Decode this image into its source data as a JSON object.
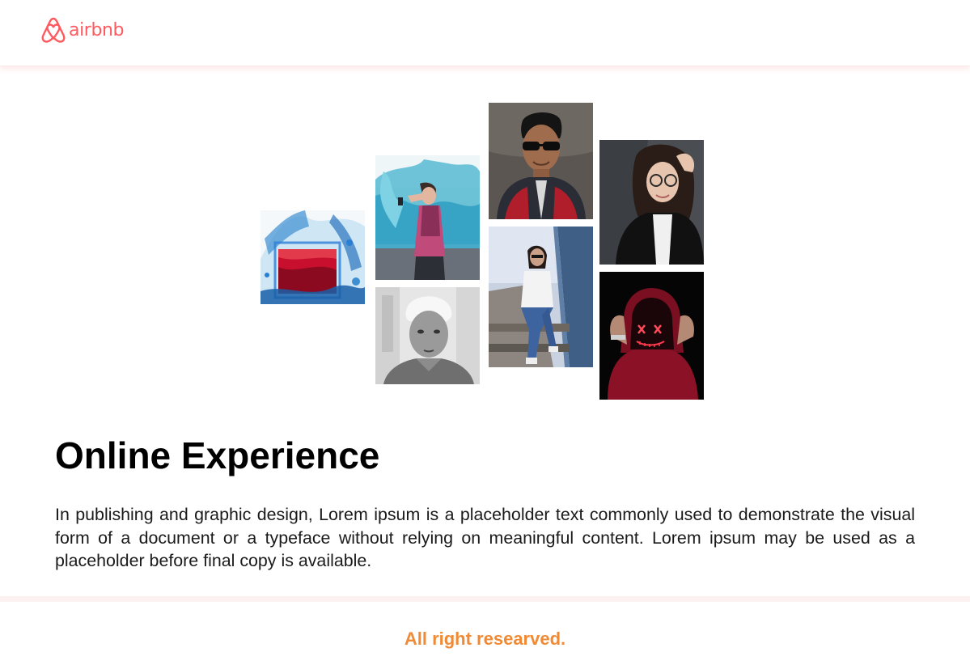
{
  "brand": {
    "name": "airbnb",
    "color": "#ff5a5f"
  },
  "gallery": {
    "images": [
      {
        "name": "red-liquid-glass-photo",
        "subject": "glass of red liquid splashing in blue water"
      },
      {
        "name": "woman-smoke-photo",
        "subject": "woman holding blue smoke flare"
      },
      {
        "name": "man-sunglasses-photo",
        "subject": "man wearing sunglasses"
      },
      {
        "name": "woman-glasses-photo",
        "subject": "woman with glasses in black jacket"
      },
      {
        "name": "man-portrait-bw-photo",
        "subject": "black and white portrait of a man"
      },
      {
        "name": "woman-steps-photo",
        "subject": "woman sitting on steps"
      },
      {
        "name": "neon-mask-hoodie-photo",
        "subject": "person in red hoodie wearing neon mask"
      }
    ]
  },
  "main": {
    "title": "Online Experience",
    "description": "In publishing and graphic design, Lorem ipsum is a placeholder text commonly used to demonstrate the visual form of a document or a typeface without relying on meaningful content. Lorem ipsum may be used as a placeholder before final copy is available."
  },
  "footer": {
    "text": "All right researved.",
    "color": "#f08a34"
  }
}
